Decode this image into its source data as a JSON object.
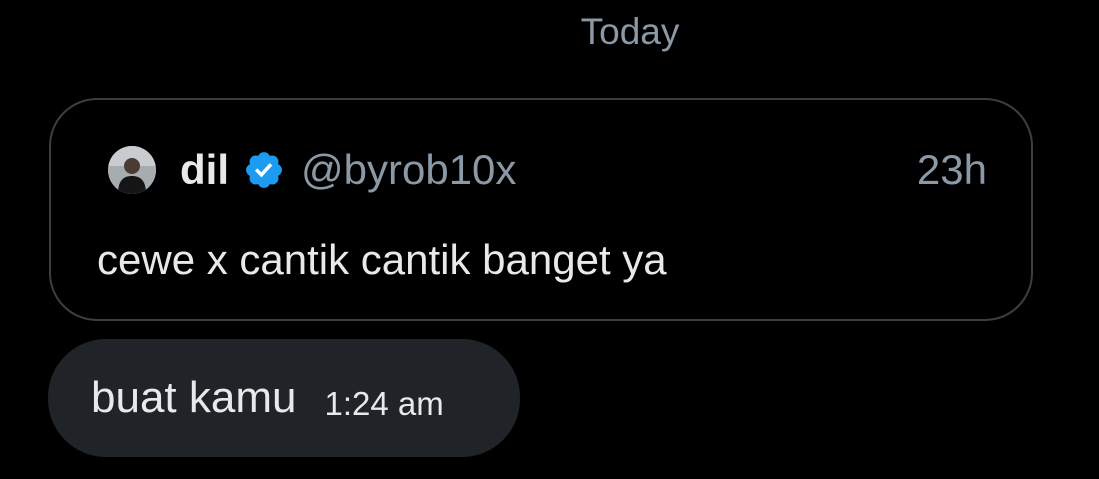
{
  "date_divider": "Today",
  "quoted_post": {
    "display_name": "dil",
    "verified": true,
    "handle": "@byrob10x",
    "time_ago": "23h",
    "text": "cewe x cantik cantik banget ya",
    "avatar_icon": "user-avatar",
    "verified_icon": "verified-badge-icon"
  },
  "message": {
    "text": "buat kamu",
    "time": "1:24 am"
  },
  "colors": {
    "background": "#000000",
    "bubble": "#202327",
    "primary_text": "#e7e9ea",
    "secondary_text": "#8b98a5",
    "card_border": "#3b3f44",
    "verified_blue": "#1d9bf0"
  }
}
